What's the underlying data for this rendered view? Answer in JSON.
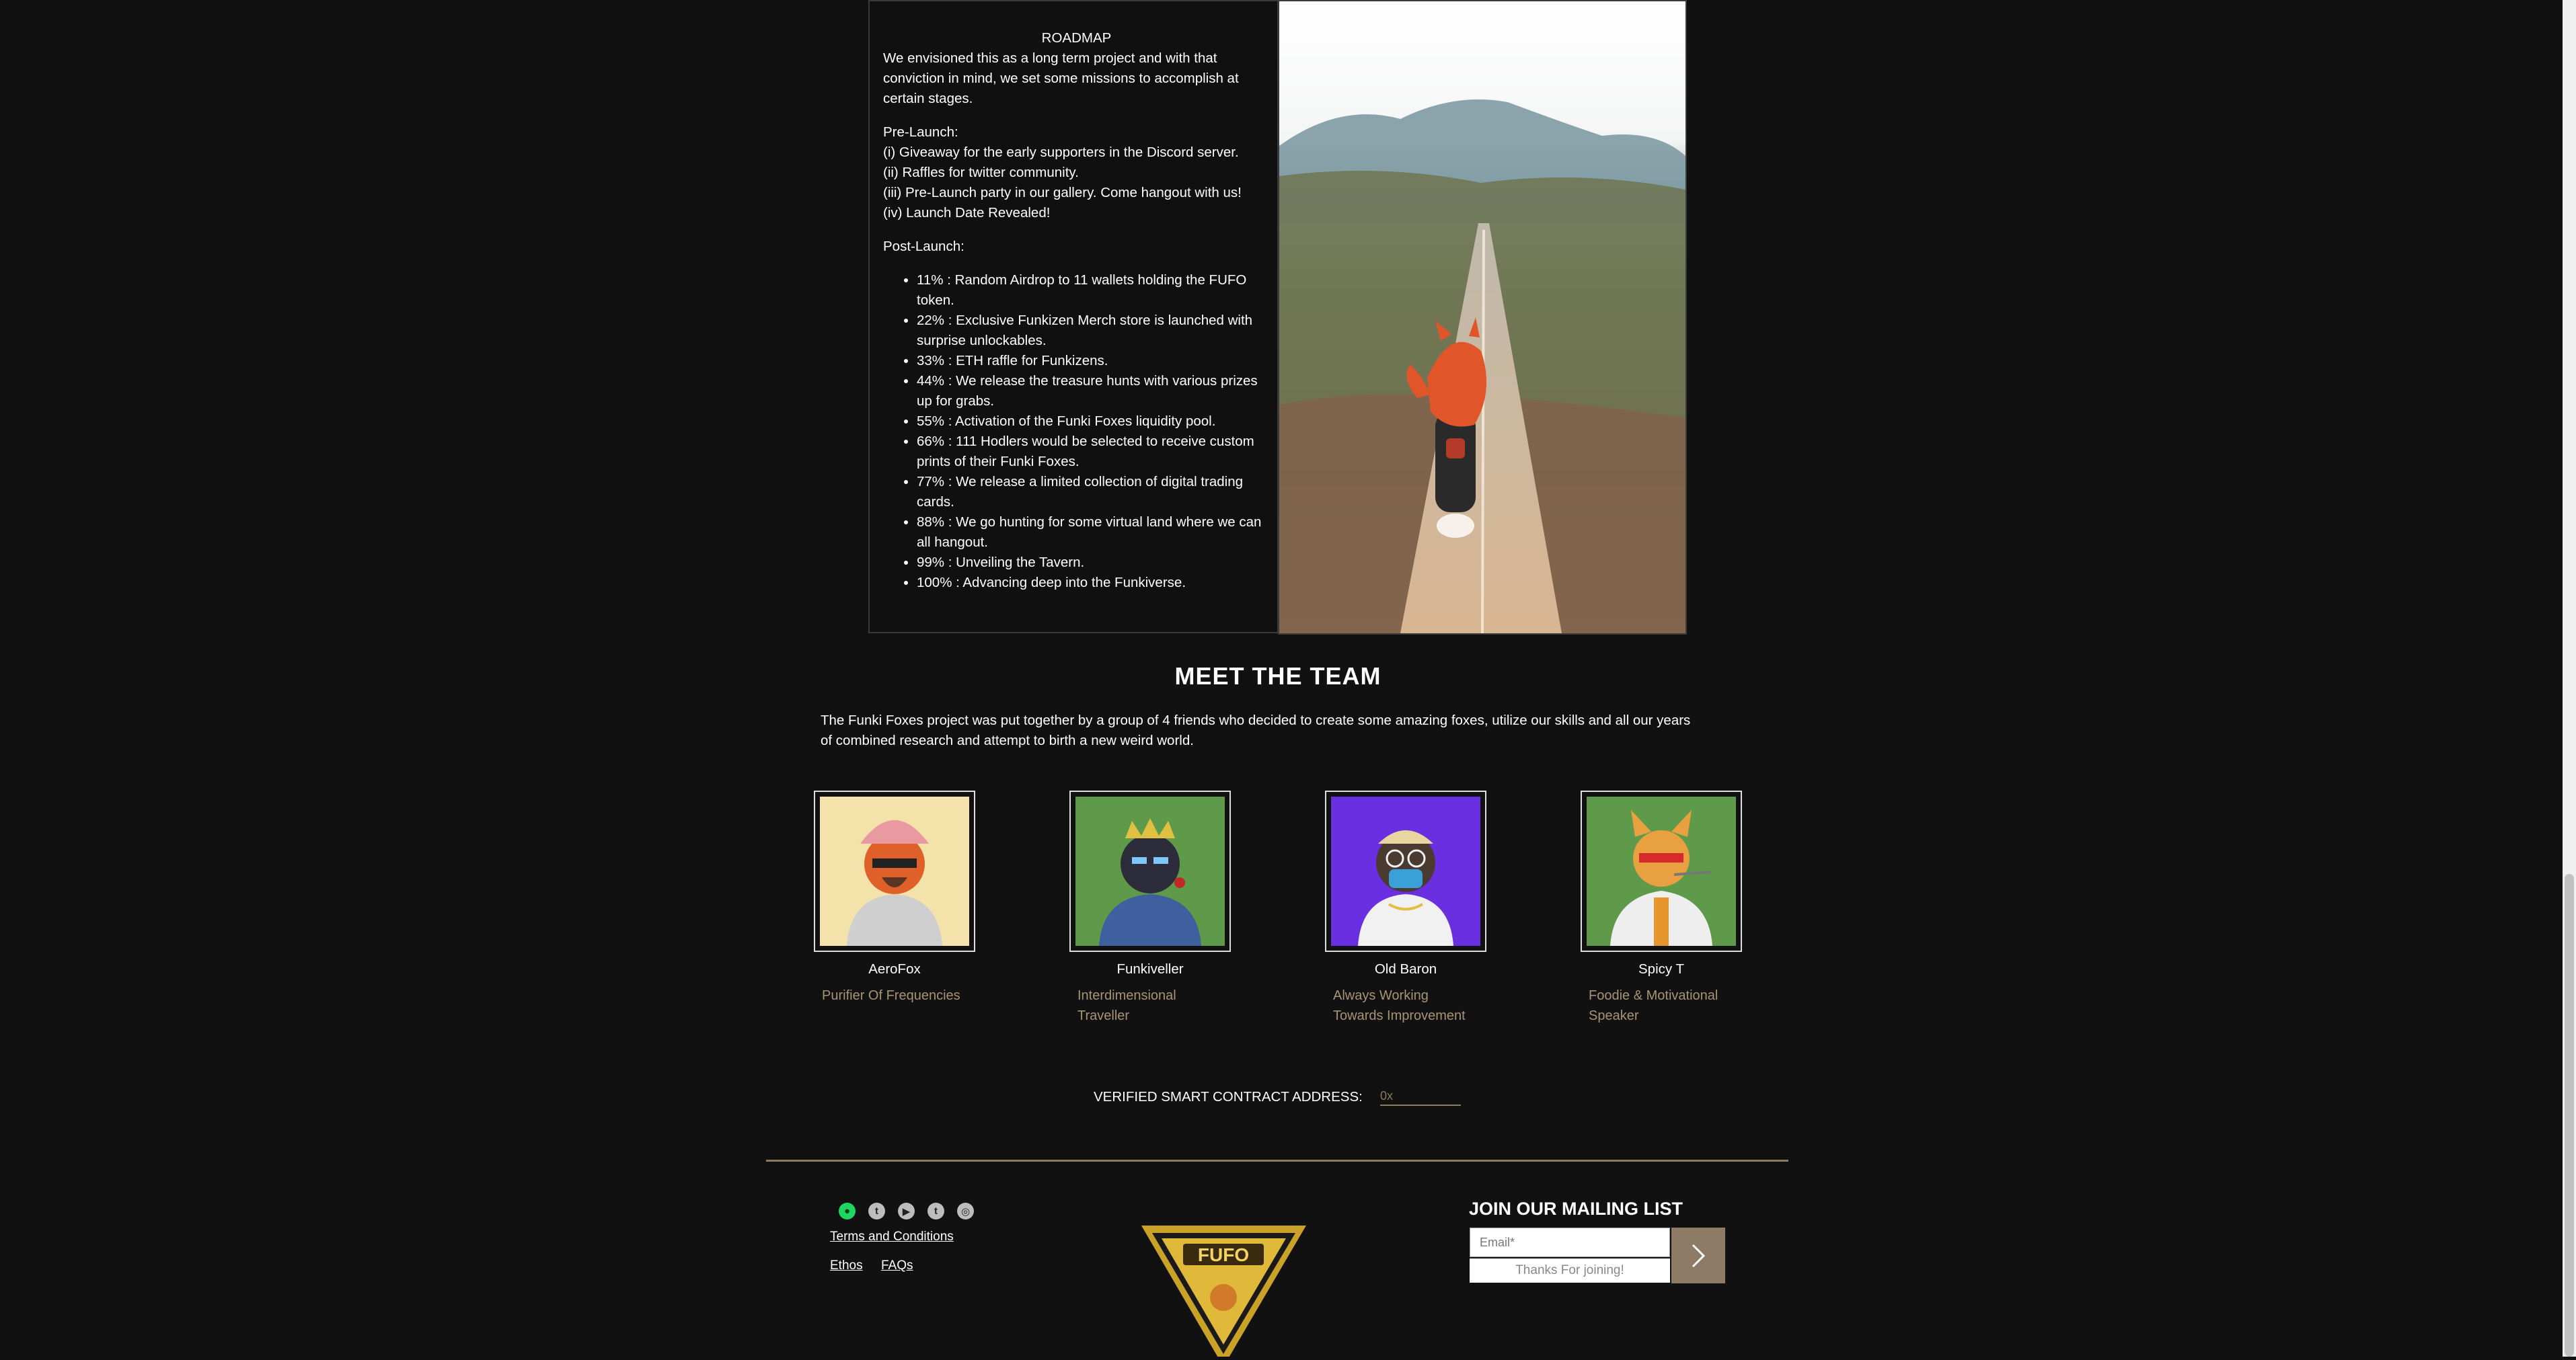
{
  "roadmap": {
    "title": "ROADMAP",
    "intro": "We envisioned this as a long term project and with that conviction in mind, we set some missions to accomplish at certain stages.",
    "pre_launch_heading": "Pre-Launch:",
    "pre_launch_items": [
      "(i) Giveaway for the early supporters in the Discord server.",
      "(ii) Raffles for twitter community.",
      "(iii) Pre-Launch party in our gallery. Come hangout with us!",
      "(iv) Launch Date Revealed!"
    ],
    "post_launch_heading": "Post-Launch:",
    "post_launch_items": [
      "11% : Random Airdrop to 11 wallets holding the FUFO token.",
      "22% : Exclusive Funkizen Merch store is launched with surprise unlockables.",
      "33% : ETH raffle for Funkizens.",
      "44% : We release the treasure hunts with various prizes up for grabs.",
      "55% : Activation of the Funki Foxes liquidity pool.",
      "66% : 111 Hodlers would be selected to receive custom prints of their Funki Foxes.",
      "77% : We release a limited collection of digital trading cards.",
      "88% : We go hunting for some virtual land where we can all hangout.",
      "99% : Unveiling the Tavern.",
      "100% : Advancing deep into the Funkiverse."
    ]
  },
  "team": {
    "title": "MEET THE TEAM",
    "intro": "The Funki Foxes project was put together by a group of 4 friends who decided to create some amazing foxes, utilize our skills and all our years of combined research and attempt to birth a new weird world.",
    "members": [
      {
        "name": "AeroFox",
        "role": "Purifier Of Frequencies",
        "bg": "#f3e2a9"
      },
      {
        "name": "Funkiveller",
        "role": "Interdimensional Traveller",
        "bg": "#5e9a49"
      },
      {
        "name": "Old Baron",
        "role": "Always Working Towards Improvement",
        "bg": "#6a2fe0"
      },
      {
        "name": "Spicy T",
        "role": "Foodie & Motivational Speaker",
        "bg": "#5e9a49"
      }
    ]
  },
  "contract": {
    "label": "VERIFIED SMART CONTRACT ADDRESS:",
    "value": "0x"
  },
  "footer": {
    "social_icons": [
      "spotify-icon",
      "twitter-icon",
      "youtube-icon",
      "tumblr-icon",
      "instagram-icon"
    ],
    "social_glyphs": [
      "●",
      "t",
      "▶",
      "t",
      "◎"
    ],
    "terms": "Terms and Conditions",
    "ethos": "Ethos",
    "faqs": "FAQs",
    "logo_text": "FUFO"
  },
  "mailing": {
    "title": "JOIN OUR MAILING LIST",
    "email_placeholder": "Email*",
    "thanks": "Thanks For joining!"
  },
  "colors": {
    "background": "#111111",
    "accent": "#8a7a5e",
    "role_text": "#a89474",
    "button": "#8d7b66"
  }
}
